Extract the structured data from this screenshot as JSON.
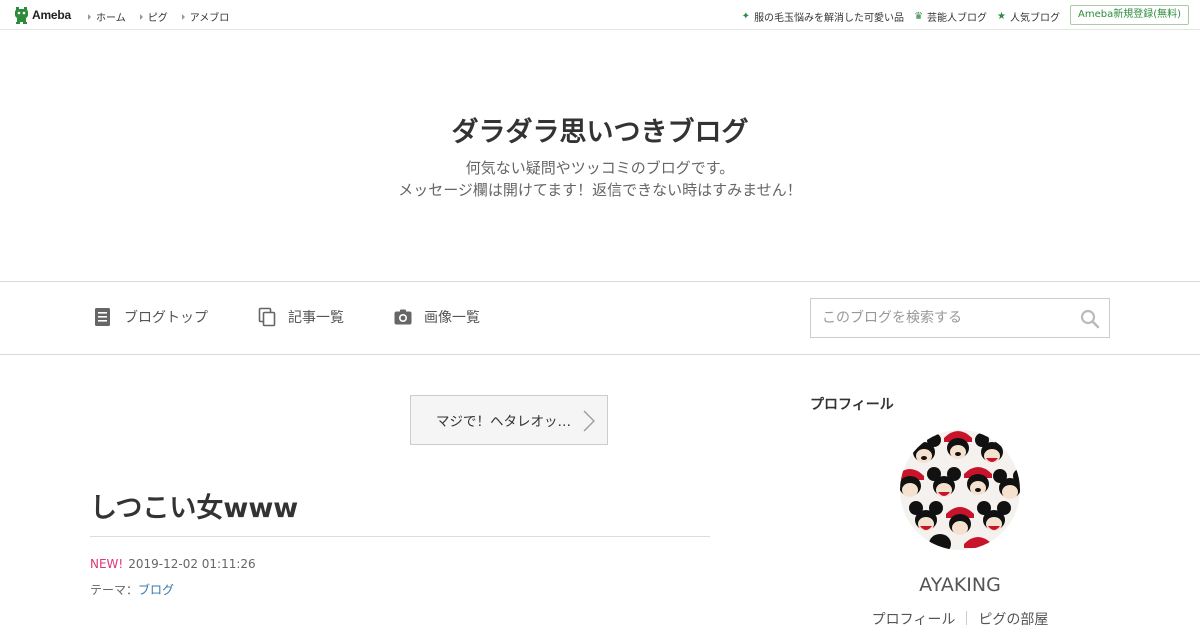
{
  "topbar": {
    "logo_text": "Ameba",
    "nav": [
      "ホーム",
      "ピグ",
      "アメブロ"
    ],
    "links": [
      {
        "label": "服の毛玉悩みを解消した可愛い品",
        "icon": "sparkle-icon"
      },
      {
        "label": "芸能人ブログ",
        "icon": "crown-icon"
      },
      {
        "label": "人気ブログ",
        "icon": "star-icon"
      }
    ],
    "register_label": "Ameba新規登録(無料)"
  },
  "header": {
    "title": "ダラダラ思いつきブログ",
    "description_line1": "何気ない疑問やツッコミのブログです。",
    "description_line2": "メッセージ欄は開けてます！返信できない時はすみません！"
  },
  "nav": {
    "blog_top": "ブログトップ",
    "entry_list": "記事一覧",
    "image_list": "画像一覧",
    "search_placeholder": "このブログを検索する"
  },
  "article": {
    "prev_label": "マジで！ヘタレオッ…",
    "title": "しつこい女www",
    "new_badge": "NEW!",
    "datetime": "2019-12-02 01:11:26",
    "theme_label": "テーマ：",
    "theme_value": "ブログ"
  },
  "sidebar": {
    "profile_heading": "プロフィール",
    "name": "AYAKING",
    "links": [
      "プロフィール",
      "ピグの部屋"
    ]
  },
  "colors": {
    "brand_green": "#2d8c3c",
    "new_badge": "#e0347a",
    "link_blue": "#3577a8"
  }
}
